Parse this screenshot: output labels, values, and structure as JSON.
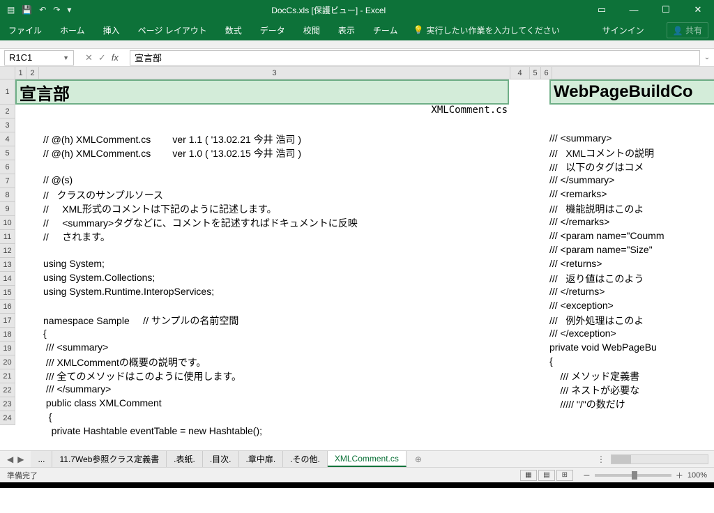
{
  "titlebar": {
    "title": "DocCs.xls  [保護ビュー] - Excel",
    "save_icon": "💾",
    "undo_icon": "↶",
    "redo_icon": "↷",
    "custom_icon": "▾",
    "ribbon_opts": "▭",
    "minimize": "—",
    "maximize": "☐",
    "close": "✕"
  },
  "ribbon": {
    "file": "ファイル",
    "home": "ホーム",
    "insert": "挿入",
    "layout": "ページ レイアウト",
    "formulas": "数式",
    "data": "データ",
    "review": "校閲",
    "view": "表示",
    "team": "チーム",
    "tellme_icon": "💡",
    "tellme": "実行したい作業を入力してください",
    "signin": "サインイン",
    "share_icon": "👤",
    "share": "共有"
  },
  "formula": {
    "name_box": "R1C1",
    "cancel": "✕",
    "confirm": "✓",
    "fx": "fx",
    "value": "宣言部"
  },
  "cols": {
    "c1": "1",
    "c2": "2",
    "c3": "3",
    "c4": "4",
    "c5": "5",
    "c6": "6"
  },
  "rows": [
    "1",
    "2",
    "3",
    "4",
    "5",
    "6",
    "7",
    "8",
    "9",
    "10",
    "11",
    "12",
    "13",
    "14",
    "15",
    "16",
    "17",
    "18",
    "19",
    "20",
    "21",
    "22",
    "23",
    "24"
  ],
  "cells": {
    "header_left": "宣言部",
    "header_right": "WebPageBuildCo",
    "subtitle": "XMLComment.cs"
  },
  "code_left": [
    "",
    "// @(h) XMLComment.cs        ver 1.1 ( '13.02.21 今井 浩司 )",
    "// @(h) XMLComment.cs        ver 1.0 ( '13.02.15 今井 浩司 )",
    "",
    "// @(s)",
    "//   クラスのサンプルソース",
    "//     XML形式のコメントは下記のように記述します。",
    "//     <summary>タグなどに、コメントを記述すればドキュメントに反映",
    "//     されます。",
    "",
    "using System;",
    "using System.Collections;",
    "using System.Runtime.InteropServices;",
    "",
    "namespace Sample     // サンプルの名前空間",
    "{",
    " /// <summary>",
    " /// XMLCommentの概要の説明です。",
    " /// 全てのメソッドはこのように使用します。",
    " /// </summary>",
    " public class XMLComment",
    "  {",
    "   private Hashtable eventTable = new Hashtable();"
  ],
  "code_right": [
    "",
    "/// <summary>",
    "///   XMLコメントの説明",
    "///   以下のタグはコメ",
    "/// </summary>",
    "/// <remarks>",
    "///   機能説明はこのよ",
    "/// </remarks>",
    "/// <param name=\"Coumm",
    "/// <param name=\"Size\"",
    "/// <returns>",
    "///   返り値はこのよう",
    "/// </returns>",
    "/// <exception>",
    "///   例外処理はこのよ",
    "/// </exception>",
    "private void WebPageBu",
    "{",
    "    /// メソッド定義書",
    "    /// ネストが必要な",
    "    ///// \"/\"の数だけ",
    "",
    ""
  ],
  "tabs": {
    "overflow": "...",
    "t1": "11.7Web参照クラス定義書",
    "t2": ".表紙.",
    "t3": ".目次.",
    "t4": ".章中扉.",
    "t5": ".その他.",
    "t6": "XMLComment.cs",
    "add": "⊕",
    "more": "⋮"
  },
  "status": {
    "ready": "準備完了",
    "view1": "▦",
    "view2": "▤",
    "view3": "⊞",
    "minus": "－",
    "plus": "＋",
    "zoom": "100%"
  }
}
